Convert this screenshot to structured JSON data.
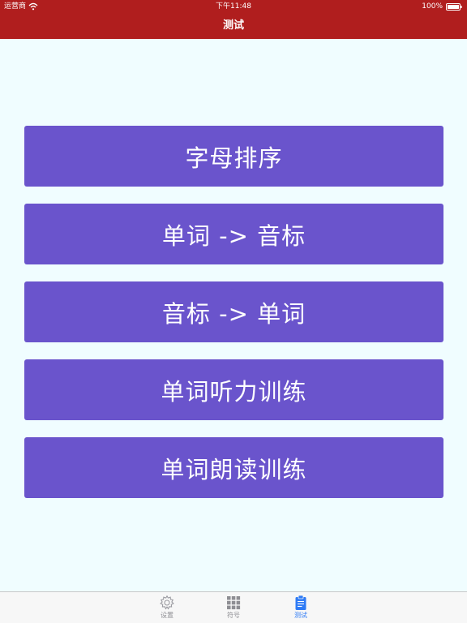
{
  "status_bar": {
    "carrier": "运营商",
    "time": "下午11:48",
    "battery": "100%"
  },
  "nav": {
    "title": "测试"
  },
  "menu": [
    {
      "label": "字母排序"
    },
    {
      "label": "单词 -> 音标"
    },
    {
      "label": "音标 -> 单词"
    },
    {
      "label": "单词听力训练"
    },
    {
      "label": "单词朗读训练"
    }
  ],
  "tabbar": {
    "items": [
      {
        "label": "设置",
        "icon": "gear-icon",
        "active": false
      },
      {
        "label": "符号",
        "icon": "grid-icon",
        "active": false
      },
      {
        "label": "测试",
        "icon": "clipboard-icon",
        "active": true
      }
    ]
  },
  "colors": {
    "nav_bar": "#b01e1e",
    "background": "#f0fdff",
    "button": "#6a54cc",
    "tab_active": "#2f7bf5",
    "tab_inactive": "#8e8e93"
  }
}
